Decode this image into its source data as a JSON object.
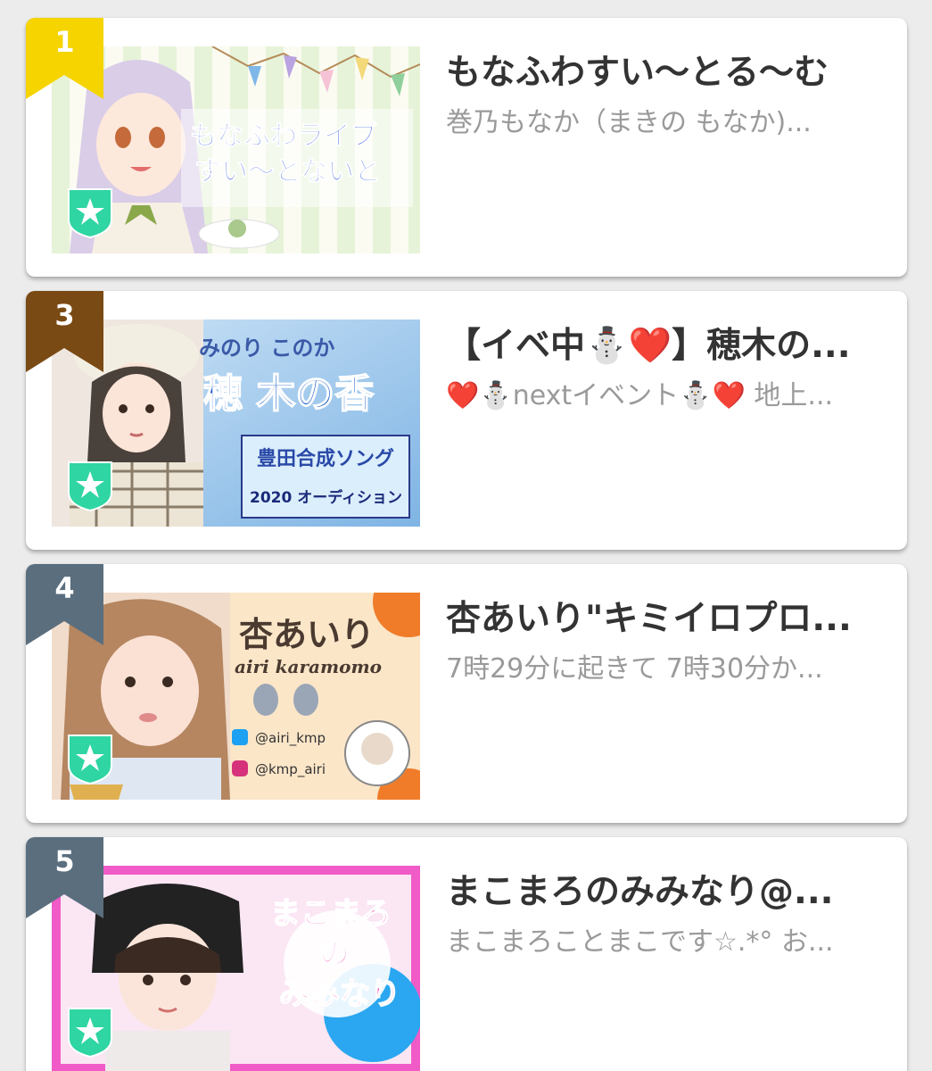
{
  "items": [
    {
      "rank": "1",
      "rank_color": "#f5d400",
      "title": "もなふわすい〜とる〜む",
      "description": "巻乃もなか（まきの もなか)...",
      "thumb_caption_lines": [
        "もなふわライブ",
        "すい〜とないと"
      ]
    },
    {
      "rank": "3",
      "rank_color": "#7a4a14",
      "title": "【イベ中⛄❤️】穂木の...",
      "description": "❤️⛄nextイベント⛄❤️ 地上...",
      "thumb_caption_lines": [
        "みのり このか",
        "穂 木の香",
        "豊田合成ソング",
        "2020 オーディション"
      ]
    },
    {
      "rank": "4",
      "rank_color": "#5a6e7e",
      "title": "杏あいり\"キミイロプロ...",
      "description": "7時29分に起きて 7時30分か...",
      "thumb_caption_lines": [
        "杏あいり",
        "airi karamomo",
        "@airi_kmp",
        "@kmp_airi"
      ]
    },
    {
      "rank": "5",
      "rank_color": "#5a6e7e",
      "title": "まこまろのみみなり@...",
      "description": "まこまろことまこです☆.*° お...",
      "thumb_caption_lines": [
        "まこまろ",
        "の",
        "みみなり"
      ]
    }
  ],
  "badge_icon": "shield-star-icon",
  "badge_color": "#2fd5a2"
}
